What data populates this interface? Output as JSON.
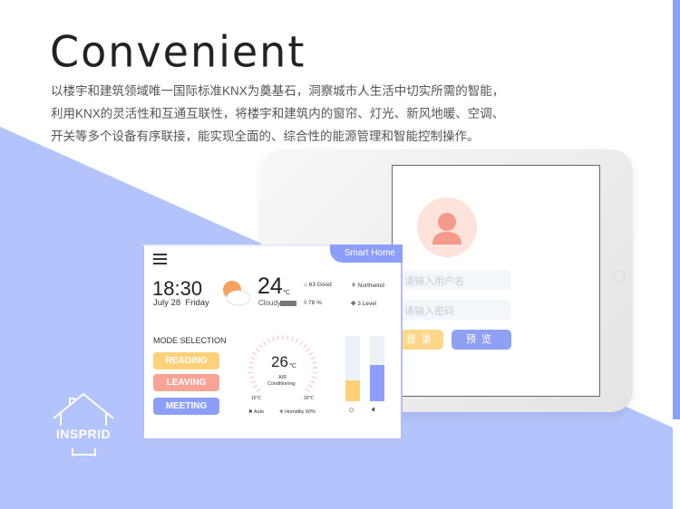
{
  "title": "Convenient",
  "description": [
    "以楼宇和建筑领域唯一国际标准KNX为奠基石，洞察城市人生活中切实所需的智能，",
    "利用KNX的灵活性和互通互联性，将楼宇和建筑内的窗帘、灯光、新风地暖、空调、",
    "开关等多个设备有序联接，能实现全面的、综合性的能源管理和智能控制操作。"
  ],
  "colors": {
    "accent": "#8c9ef9",
    "background_light": "#b3c3fb",
    "reading": "#fdd17a",
    "leaving": "#f8a395",
    "meeting": "#8c9ef9"
  },
  "login": {
    "username_placeholder": "请输入用户名",
    "password_placeholder": "请输入密码",
    "login_label": "登录",
    "preview_label": "预览"
  },
  "panel": {
    "tab": "Smart Home",
    "time": "18:30",
    "date": "July 28  Friday",
    "temperature": "24",
    "temp_unit": "℃",
    "weather": "Cloudy",
    "air_quality": "63 Good",
    "wind": "Northwind",
    "humidity": "78 %",
    "wind_level": "3 Level",
    "mode_title": "MODE SELECTION",
    "modes": [
      "READING",
      "LEAVING",
      "MEETING"
    ],
    "ac_temp": "26",
    "ac_unit": "℃",
    "ac_label_1": "AIR",
    "ac_label_2": "Conditioning",
    "ac_min": "16℃",
    "ac_max": "30℃",
    "ac_mode": "Auto",
    "ac_humidity": "Humidity 60%",
    "light_level": 0.32,
    "volume_level": 0.55
  },
  "logo": "INSPRID"
}
